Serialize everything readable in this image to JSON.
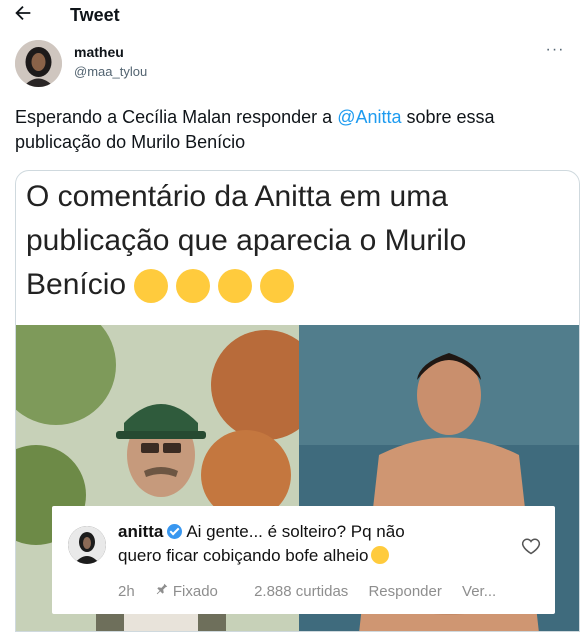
{
  "topbar": {
    "title": "Tweet",
    "back_icon": "arrow-left-icon"
  },
  "author": {
    "display_name": "matheu",
    "handle": "@maa_tylou",
    "more_icon": "more-horizontal-icon",
    "more_label": "···"
  },
  "tweet": {
    "text_before": "Esperando a Cecília Malan responder a ",
    "mention": "@Anitta",
    "text_after": " sobre essa publicação do Murilo Benício"
  },
  "media": {
    "caption": "O comentário da Anitta em uma publicação que aparecia o Murilo Benício",
    "caption_emojis": [
      "laughing-crying-emoji",
      "laughing-crying-emoji",
      "laughing-crying-emoji",
      "laughing-crying-emoji"
    ],
    "comment": {
      "username": "anitta",
      "verified_icon": "verified-badge-icon",
      "line1": "Ai gente... é solteiro? Pq não",
      "line2": "quero ficar cobiçando bofe alheio",
      "line2_emoji": "crying-face-emoji",
      "time": "2h",
      "pinned": "Fixado",
      "likes": "2.888 curtidas",
      "reply": "Responder",
      "more": "Ver..."
    }
  },
  "colors": {
    "mention": "#1d9bf0",
    "secondary_text": "#536471",
    "verified": "#3897f0"
  }
}
